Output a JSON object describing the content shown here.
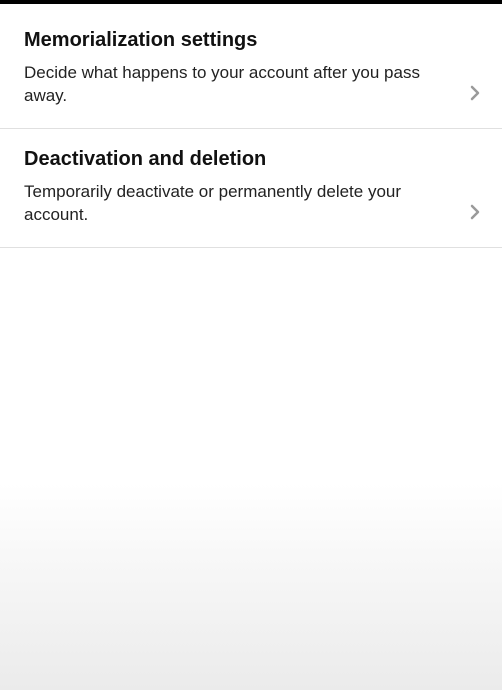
{
  "settings": {
    "items": [
      {
        "title": "Memorialization settings",
        "description": "Decide what happens to your account after you pass away."
      },
      {
        "title": "Deactivation and deletion",
        "description": "Temporarily deactivate or permanently delete your account."
      }
    ]
  }
}
